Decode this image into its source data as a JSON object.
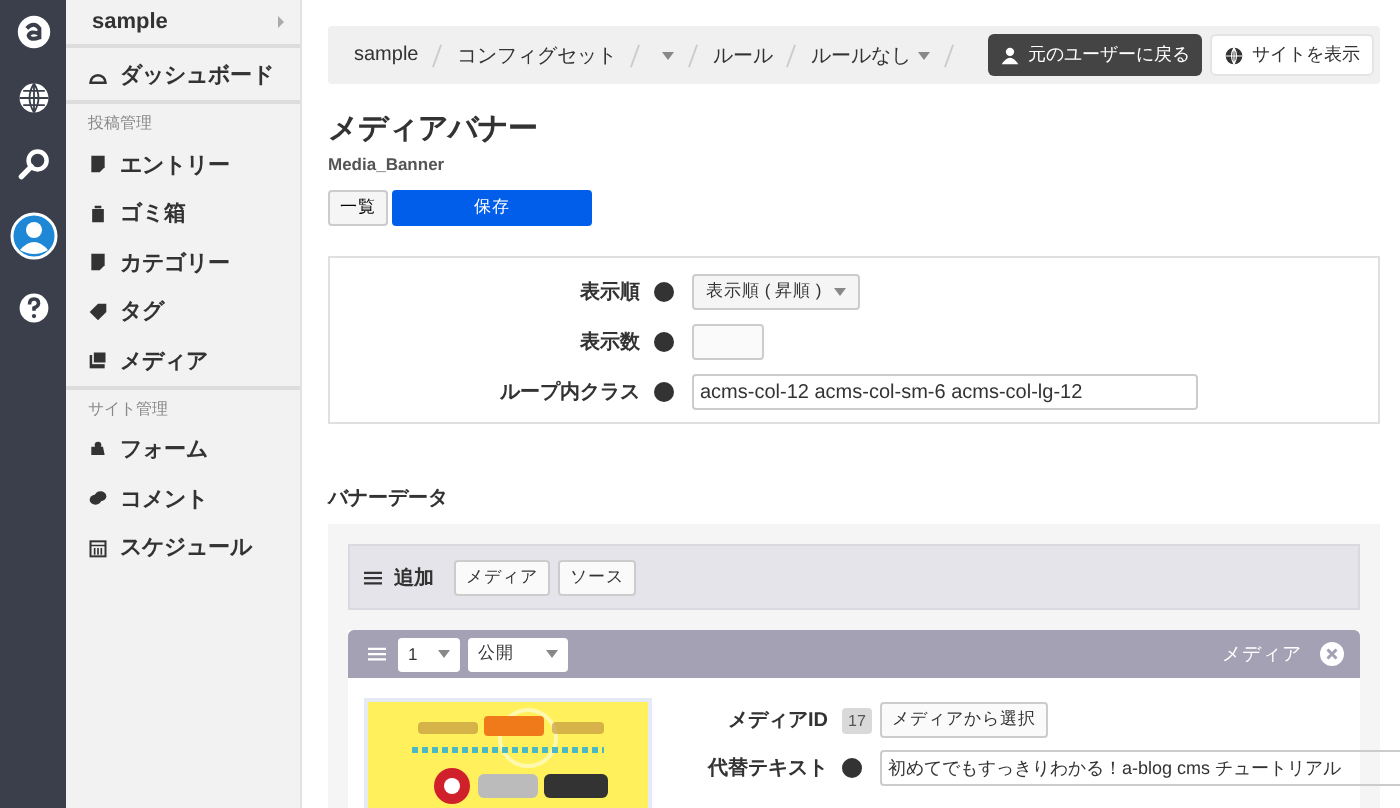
{
  "sidebar": {
    "site": "sample",
    "dashboard": "ダッシュボード",
    "sections": [
      {
        "label": "投稿管理",
        "items": [
          "エントリー",
          "ゴミ箱",
          "カテゴリー",
          "タグ",
          "メディア"
        ]
      },
      {
        "label": "サイト管理",
        "items": [
          "フォーム",
          "コメント",
          "スケジュール"
        ]
      }
    ]
  },
  "breadcrumbs": [
    {
      "label": "sample",
      "dropdown": false
    },
    {
      "label": "コンフィグセット",
      "dropdown": false
    },
    {
      "dropdown": true
    },
    {
      "label": "ルール",
      "dropdown": false
    },
    {
      "label": "ルールなし",
      "dropdown": true
    }
  ],
  "header_buttons": [
    "元のユーザーに戻る",
    "サイトを表示"
  ],
  "title": "メディアバナー",
  "subtitle": "Media_Banner",
  "actions": [
    "一覧",
    "保存"
  ],
  "fields": [
    {
      "label": "表示順",
      "kind": "select",
      "value": "表示順 ( 昇順 )"
    },
    {
      "label": "表示数",
      "kind": "text"
    },
    {
      "label": "ループ内クラス",
      "kind": "text",
      "value": "acms-col-12 acms-col-sm-6 acms-col-lg-12"
    }
  ],
  "banner": {
    "title": "バナーデータ",
    "add_label": "追加",
    "add_buttons": [
      "メディア",
      "ソース"
    ],
    "items": [
      {
        "order": "1",
        "status": "公開",
        "type_label": "メディア",
        "media_id_label": "メディアID",
        "media_id": "17",
        "select_button": "メディアから選択",
        "alt_label": "代替テキスト",
        "alt_value": "初めてでもすっきりわかる！a-blog cms チュートリアル"
      }
    ]
  }
}
